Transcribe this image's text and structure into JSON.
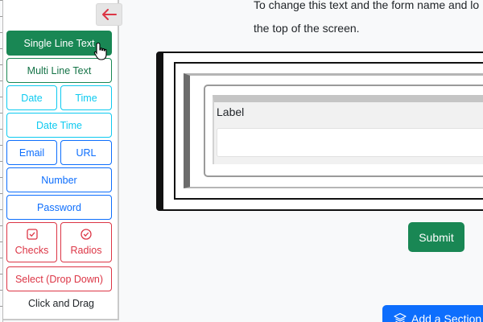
{
  "palette": {
    "collapse_icon": "arrow-left-icon",
    "single_line": "Single Line Text",
    "multi_line": "Multi Line Text",
    "date": "Date",
    "time": "Time",
    "date_time": "Date Time",
    "email": "Email",
    "url": "URL",
    "number": "Number",
    "password": "Password",
    "checks": "Checks",
    "radios": "Radios",
    "select": "Select (Drop Down)",
    "hint": "Click and Drag"
  },
  "main": {
    "intro_line1": "To change this text and the form name and lo",
    "intro_line2": "the top of the screen.",
    "field_label": "Label",
    "submit": "Submit",
    "add_section": "Add a Section"
  },
  "colors": {
    "green": "#198754",
    "cyan": "#0dcaf0",
    "blue": "#0d6efd",
    "red": "#dc3545"
  }
}
